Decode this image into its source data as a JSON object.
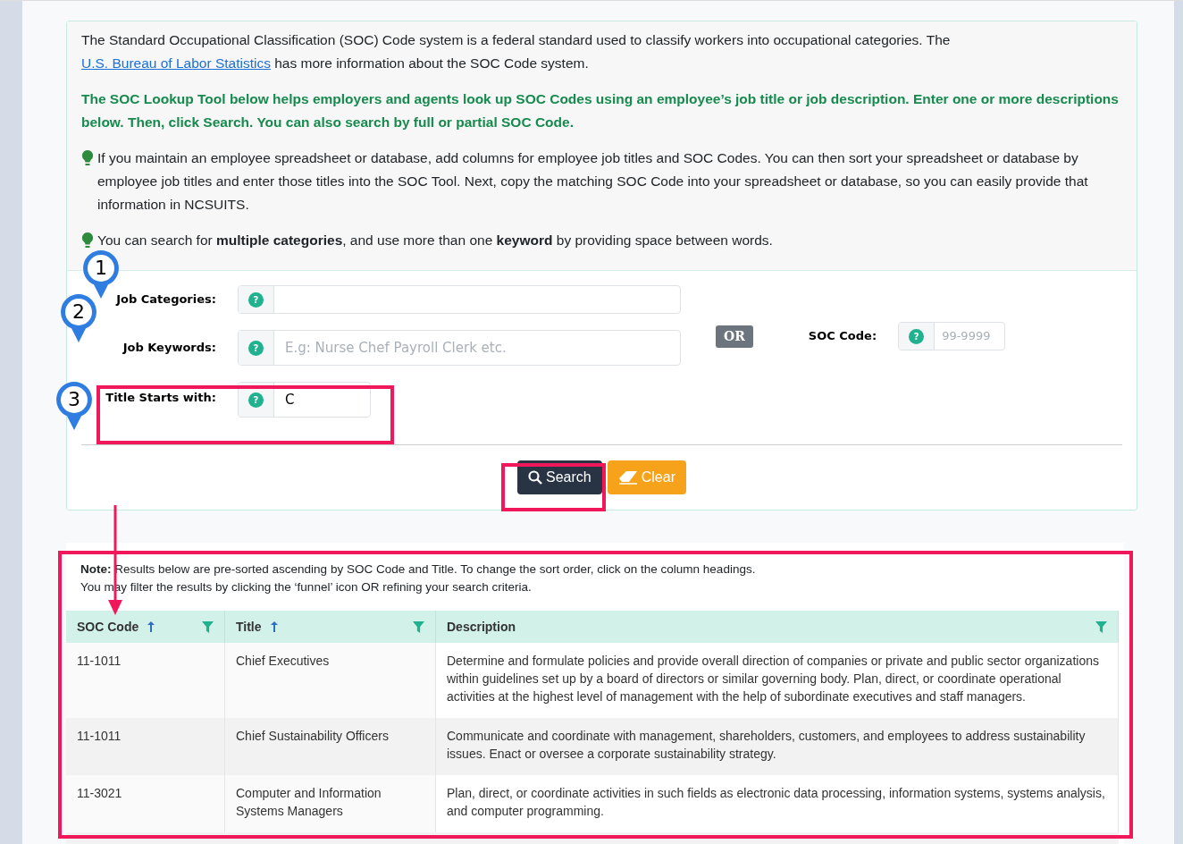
{
  "intro": {
    "text_before_link": "The Standard Occupational Classification (SOC) Code system is a federal standard used to classify workers into occupational categories. The ",
    "link": "U.S. Bureau of Labor Statistics",
    "text_after_link": " has more information about the SOC Code system."
  },
  "highlight": "The SOC Lookup Tool below helps employers and agents look up SOC Codes using an employee’s job title or job description. Enter one or more descriptions below. Then, click Search. You can also search by full or partial SOC Code.",
  "tips": [
    "If you maintain an employee spreadsheet or database, add columns for employee job titles and SOC Codes. You can then sort your spreadsheet or database by employee job titles and enter those titles into the SOC Tool. Next, copy the matching SOC Code into your spreadsheet or database, so you can easily provide that information in NCSUITS.",
    "You can search for **multiple categories**, and use more than one **keyword** by providing space between words."
  ],
  "form": {
    "job_categories": {
      "label": "Job Categories:"
    },
    "job_keywords": {
      "label": "Job Keywords:",
      "placeholder": "E.g: Nurse Chef Payroll Clerk etc."
    },
    "or_badge": "OR",
    "soc_code": {
      "label": "SOC Code:",
      "placeholder": "99-9999"
    },
    "title_starts_with": {
      "label": "Title Starts with:",
      "value": "C"
    },
    "help_icon": "?"
  },
  "buttons": {
    "search": "Search",
    "clear": "Clear"
  },
  "note": {
    "text": "**Note:** Results below are pre-sorted ascending by SOC Code and Title. To change the sort order, click on the column headings.",
    "text2": "You may filter the results by clicking the ‘funnel’ icon OR refining your search criteria."
  },
  "table": {
    "columns": [
      {
        "label": "SOC Code",
        "sorted": true,
        "filter": true
      },
      {
        "label": "Title",
        "sorted": true,
        "filter": true
      },
      {
        "label": "Description",
        "sorted": false,
        "filter": true
      }
    ],
    "rows": [
      {
        "soc_code": "11-1011",
        "title": "Chief Executives",
        "description": "Determine and formulate policies and provide overall direction of companies or private and public sector organizations within guidelines set up by a board of directors or similar governing body. Plan, direct, or coordinate operational activities at the highest level of management with the help of subordinate executives and staff managers."
      },
      {
        "soc_code": "11-1011",
        "title": "Chief Sustainability Officers",
        "description": "Communicate and coordinate with management, shareholders, customers, and employees to address sustainability issues. Enact or oversee a corporate sustainability strategy."
      },
      {
        "soc_code": "11-3021",
        "title": "Computer and Information Systems Managers",
        "description": "Plan, direct, or coordinate activities in such fields as electronic data processing, information systems, systems analysis, and computer programming."
      }
    ]
  },
  "annotations": {
    "markers": [
      "1",
      "2",
      "3"
    ]
  }
}
